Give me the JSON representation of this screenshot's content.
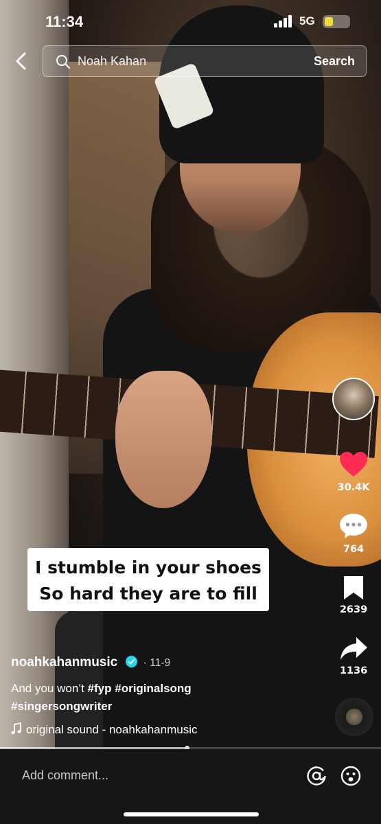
{
  "status_bar": {
    "time": "11:34",
    "network": "5G",
    "battery_level": 0.35
  },
  "search": {
    "query": "Noah Kahan",
    "button_label": "Search"
  },
  "caption_overlay": {
    "line1": "I stumble in your shoes",
    "line2": "So hard they are to fill"
  },
  "actions": {
    "likes": "30.4K",
    "comments": "764",
    "saves": "2639",
    "shares": "1136"
  },
  "post": {
    "username": "noahkahanmusic",
    "date": "· 11-9",
    "description_text": "And you won’t",
    "hashtags": [
      "#fyp",
      "#originalsong",
      "#singersongwriter"
    ],
    "sound": "original sound - noahkahanmusic"
  },
  "playback": {
    "progress": 0.49
  },
  "comment_bar": {
    "placeholder": "Add comment..."
  },
  "colors": {
    "like": "#fe2c55",
    "verified": "#20d5ec",
    "battery": "#f3d93b"
  },
  "icons": [
    "back-arrow-icon",
    "search-icon",
    "heart-icon",
    "comment-icon",
    "bookmark-icon",
    "share-icon",
    "music-note-icon",
    "at-icon",
    "emoji-icon",
    "verified-icon"
  ]
}
